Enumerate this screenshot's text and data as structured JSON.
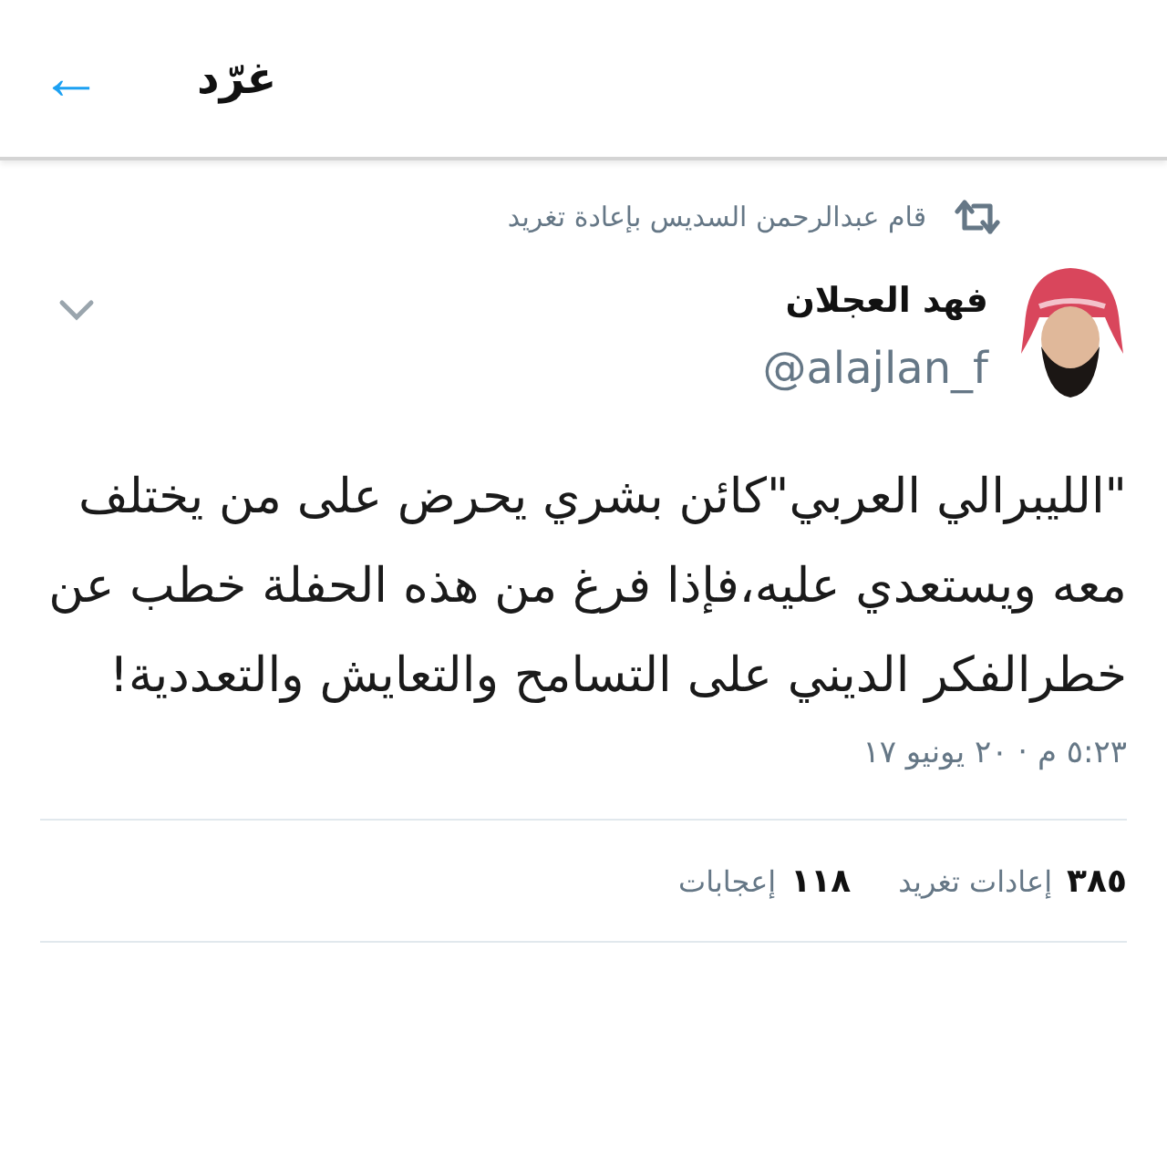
{
  "header": {
    "back": "←",
    "title": "غرّد"
  },
  "retweet_note": "قام عبدالرحمن السديس بإعادة تغريد",
  "author": {
    "name": "فهد العجلان",
    "handle": "@alajlan_f"
  },
  "tweet": {
    "text": "\"الليبرالي العربي\"كائن بشري يحرض على من يختلف معه ويستعدي عليه،فإذا فرغ من هذه الحفلة خطب عن خطرالفكر الديني على التسامح والتعايش والتعددية!",
    "timestamp": "٥:٢٣ م · ٢٠ يونيو ١٧"
  },
  "stats": [
    {
      "count": "٣٨٥",
      "label": "إعادات تغريد"
    },
    {
      "count": "١١٨",
      "label": "إعجابات"
    }
  ]
}
